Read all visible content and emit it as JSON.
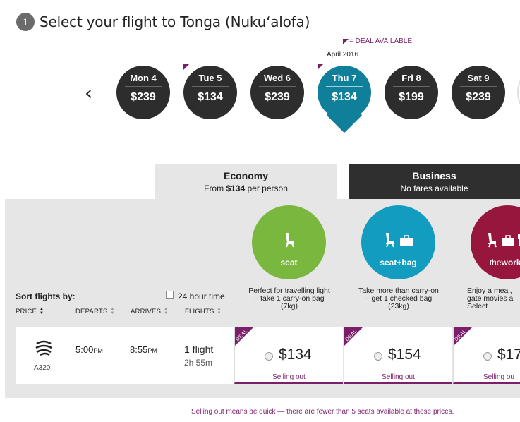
{
  "header": {
    "step": "1",
    "title": "Select your flight to Tonga (Nukuʻalofa)"
  },
  "legend": {
    "deal_label": "= DEAL AVAILABLE",
    "deal_color": "#7b1f6a"
  },
  "calendar": {
    "month": "April 2016",
    "prev_icon": "chevron-left-icon",
    "days": [
      {
        "day": "Mon 4",
        "price": "$239",
        "deal": false,
        "selected": false
      },
      {
        "day": "Tue 5",
        "price": "$134",
        "deal": true,
        "selected": false
      },
      {
        "day": "Wed 6",
        "price": "$239",
        "deal": false,
        "selected": false
      },
      {
        "day": "Thu 7",
        "price": "$134",
        "deal": true,
        "selected": true
      },
      {
        "day": "Fri 8",
        "price": "$199",
        "deal": false,
        "selected": false
      },
      {
        "day": "Sat 9",
        "price": "$239",
        "deal": false,
        "selected": false
      }
    ]
  },
  "tabs": {
    "economy": {
      "name": "Economy",
      "from": "From",
      "price": "$134",
      "per": "per person"
    },
    "business": {
      "name": "Business",
      "sub": "No fares available"
    }
  },
  "fares": [
    {
      "name": "seat",
      "icons": "seat-icon",
      "color": "#79b73e",
      "desc": "Perfect for travelling light – take 1 carry-on bag (7kg)"
    },
    {
      "name": "seat+bag",
      "icons": "seat-icon bag-icon",
      "color": "#129cbf",
      "desc": "Take more than carry-on – get 1 checked bag (23kg)"
    },
    {
      "name": "theworks",
      "name_bold": "the",
      "name_rest": "works",
      "icons": "seat-icon bag-icon meal-icon",
      "color": "#97163e",
      "desc": "Enjoy a meal, gate movies a Select"
    }
  ],
  "sort": {
    "title": "Sort flights by:",
    "hour24_label": "24 hour time",
    "columns": [
      "PRICE",
      "DEPARTS",
      "ARRIVES",
      "FLIGHTS"
    ]
  },
  "flight": {
    "aircraft": "A320",
    "depart_time": "5:00",
    "depart_ampm": "PM",
    "arrive_time": "8:55",
    "arrive_ampm": "PM",
    "flights": "1 flight",
    "duration": "2h 55m",
    "fare_cells": [
      {
        "deal": "DEAL",
        "price": "$134",
        "status": "Selling out"
      },
      {
        "deal": "DEAL",
        "price": "$154",
        "status": "Selling out"
      },
      {
        "deal": "DEAL",
        "price": "$17",
        "status": "Selling ou"
      }
    ]
  },
  "footnote": "Selling out means be quick — there are fewer than 5 seats available at these prices."
}
